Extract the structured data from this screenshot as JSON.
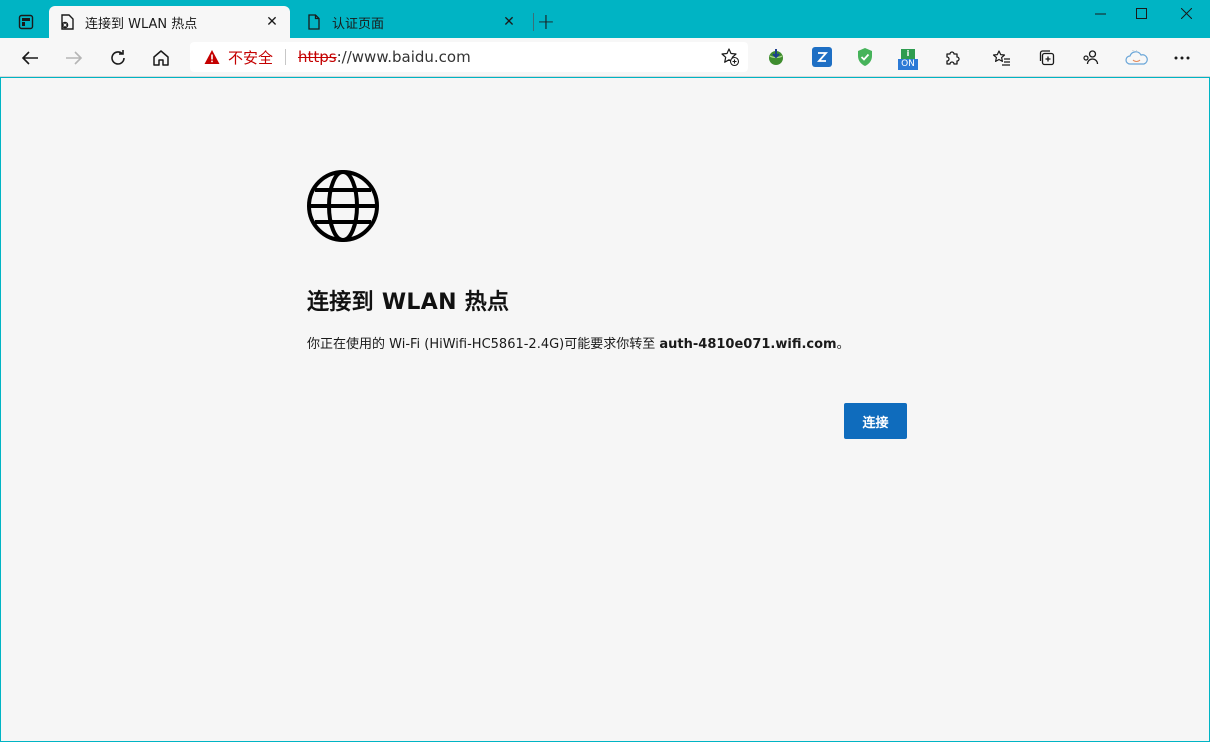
{
  "tabs": [
    {
      "title": "连接到 WLAN 热点",
      "icon": "captive-portal-icon",
      "close": "✕"
    },
    {
      "title": "认证页面",
      "icon": "page-icon",
      "close": "✕"
    }
  ],
  "new_tab": "+",
  "window_controls": {
    "minimize": "—",
    "maximize": "☐",
    "close": "✕"
  },
  "address_bar": {
    "security_label": "不安全",
    "url_scheme": "https",
    "url_rest": "://www.baidu.com"
  },
  "extensions": {
    "on_badge": "ON"
  },
  "page": {
    "heading": "连接到 WLAN 热点",
    "desc_prefix": "你正在使用的 Wi-Fi (HiWifi-HC5861-2.4G)可能要求你转至 ",
    "desc_domain": "auth-4810e071.wifi.com",
    "desc_suffix": "。",
    "connect_button": "连接"
  },
  "colors": {
    "titlebar": "#00b4c4",
    "accent_button": "#0f6cbd",
    "insecure": "#c40000"
  }
}
